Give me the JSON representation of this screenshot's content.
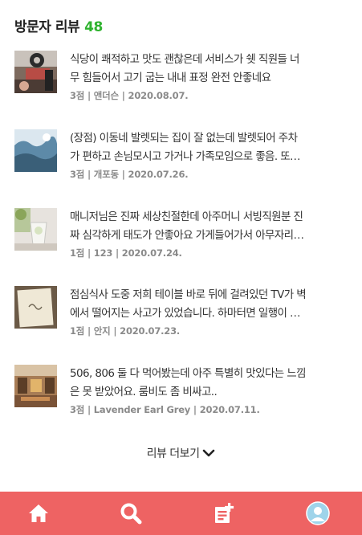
{
  "header": {
    "title": "방문자 리뷰",
    "count": "48"
  },
  "reviews": [
    {
      "line1": "식당이 쾌적하고 맛도 괜찮은데 서비스가 쉣 직원들 너",
      "line2": "무 힘들어서 고기 굽는 내내 표정 완전 안좋네요",
      "meta": "3점 | 앤더슨 | 2020.08.07."
    },
    {
      "line1": "(장점) 이동네 발렛되는 집이 잘 없는데 발렛되어 주차",
      "line2": "가 편하고 손님모시고 가거나 가족모임으로 좋음. 또…",
      "meta": "3점 | 개포동 | 2020.07.26."
    },
    {
      "line1": "매니저님은 진짜 세상친절한데 아주머니 서빙직원분 진",
      "line2": "짜 심각하게 태도가 안좋아요 가게들어가서 아무자리…",
      "meta": "1점 | 123 | 2020.07.24."
    },
    {
      "line1": "점심식사 도중 저희 테이블 바로 뒤에 걸려있던 TV가 벽",
      "line2": "에서 떨어지는 사고가 있었습니다. 하마터면 일행이 …",
      "meta": "1점 | 안지 | 2020.07.23."
    },
    {
      "line1": "506, 806 둘 다 먹어봤는데 아주 특별히 맛있다는 느낌",
      "line2": "은 못 받았어요. 룸비도 좀 비싸고..",
      "meta": "3점 | Lavender Earl Grey | 2020.07.11."
    }
  ],
  "more": {
    "label": "리뷰 더보기"
  },
  "tabbar": {
    "color": "#ee6363",
    "icons": [
      "home-icon",
      "search-icon",
      "write-review-icon",
      "profile-avatar-icon"
    ]
  }
}
